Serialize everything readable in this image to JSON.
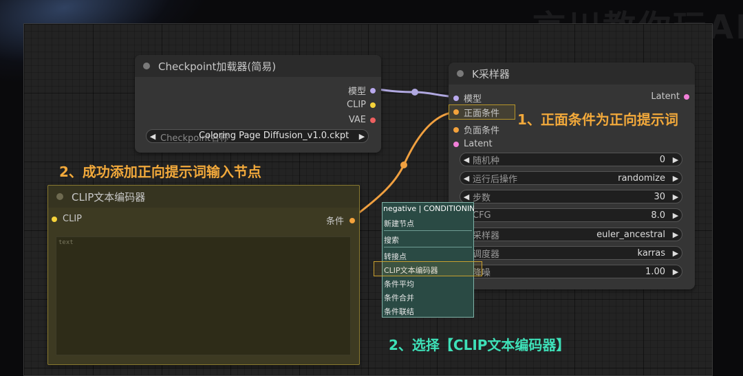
{
  "watermark": "言川教你玩AI",
  "nodes": {
    "checkpoint": {
      "title": "Checkpoint加载器(简易)",
      "outputs": [
        "模型",
        "CLIP",
        "VAE"
      ],
      "widget_label": "Checkpoint名称",
      "widget_value": "Coloring Page Diffusion_v1.0.ckpt"
    },
    "ksampler": {
      "title": "K采样器",
      "inputs": [
        "模型",
        "正面条件",
        "负面条件",
        "Latent"
      ],
      "output": "Latent",
      "widgets": [
        {
          "label": "随机种",
          "value": "0"
        },
        {
          "label": "运行后操作",
          "value": "randomize"
        },
        {
          "label": "步数",
          "value": "30"
        },
        {
          "label": "CFG",
          "value": "8.0"
        },
        {
          "label": "采样器",
          "value": "euler_ancestral"
        },
        {
          "label": "调度器",
          "value": "karras"
        },
        {
          "label": "降噪",
          "value": "1.00"
        }
      ]
    },
    "clip": {
      "title": "CLIP文本编码器",
      "input": "CLIP",
      "output": "条件",
      "text_placeholder": "text"
    }
  },
  "context_menu": {
    "header": "negative | CONDITIONING",
    "items": [
      "新建节点",
      "搜索",
      "转接点",
      "CLIP文本编码器",
      "条件平均",
      "条件合并",
      "条件联结"
    ]
  },
  "annotations": {
    "a1": "1、正面条件为正向提示词",
    "a2": "2、成功添加正向提示词输入节点",
    "a3": "2、选择【CLIP文本编码器】"
  },
  "colors": {
    "annotation_orange": "#f2a93b",
    "annotation_teal": "#3ee0b8",
    "wire_model": "#b0a8e0",
    "wire_conditioning": "#f0a040",
    "pin_model": "#b9a9ee",
    "pin_clip": "#f5d23a",
    "pin_vae": "#ee6060",
    "pin_conditioning": "#f4a23c",
    "pin_latent": "#f17fd8"
  }
}
